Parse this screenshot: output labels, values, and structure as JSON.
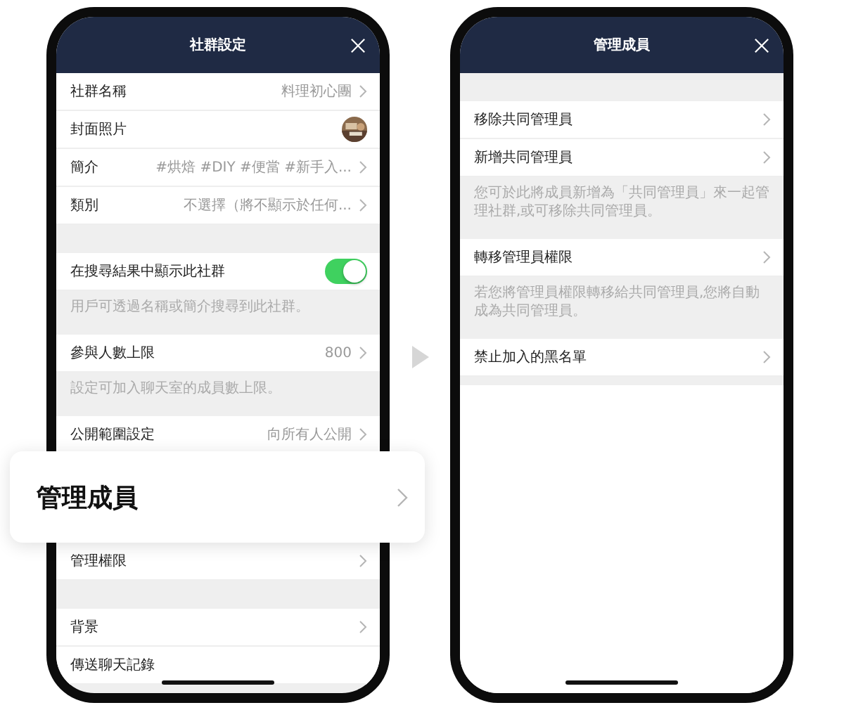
{
  "left_phone": {
    "title": "社群設定",
    "items": [
      {
        "kind": "row",
        "label": "社群名稱",
        "value": "料理初心團",
        "chevron": true
      },
      {
        "label": "封面照片"
      },
      {
        "kind": "row",
        "label": "簡介",
        "value": "#烘焙 #DIY #便當 #新手入...",
        "chevron": true
      },
      {
        "kind": "row",
        "label": "類別",
        "value": "不選擇（將不顯示於任何...",
        "chevron": true
      },
      {
        "kind": "gap"
      },
      {
        "kind": "toggle",
        "label": "在搜尋結果中顯示此社群",
        "on": true
      },
      {
        "kind": "note",
        "text": "用戶可透過名稱或簡介搜尋到此社群。"
      },
      {
        "kind": "row",
        "label": "參與人數上限",
        "value": "800",
        "chevron": true
      },
      {
        "kind": "note",
        "text": "設定可加入聊天室的成員數上限。"
      },
      {
        "kind": "row",
        "label": "公開範圍設定",
        "value": "向所有人公開",
        "chevron": true
      },
      {
        "kind": "covered"
      },
      {
        "kind": "row",
        "label": "管理權限",
        "chevron": true
      },
      {
        "kind": "gap"
      },
      {
        "kind": "row",
        "label": "背景",
        "chevron": true
      },
      {
        "kind": "row",
        "label": "傳送聊天記錄",
        "chevron": false
      }
    ]
  },
  "callout": {
    "label": "管理成員"
  },
  "right_phone": {
    "title": "管理成員",
    "items": [
      {
        "kind": "gap"
      },
      {
        "kind": "row",
        "label": "移除共同管理員",
        "chevron": true
      },
      {
        "kind": "row",
        "label": "新增共同管理員",
        "chevron": true
      },
      {
        "kind": "note",
        "text": "您可於此將成員新增為「共同管理員」來一起管理社群,或可移除共同管理員。"
      },
      {
        "kind": "row",
        "label": "轉移管理員權限",
        "chevron": true
      },
      {
        "kind": "note",
        "text": "若您將管理員權限轉移給共同管理員,您將自動成為共同管理員。"
      },
      {
        "kind": "row",
        "label": "禁止加入的黑名單",
        "chevron": true
      }
    ]
  }
}
